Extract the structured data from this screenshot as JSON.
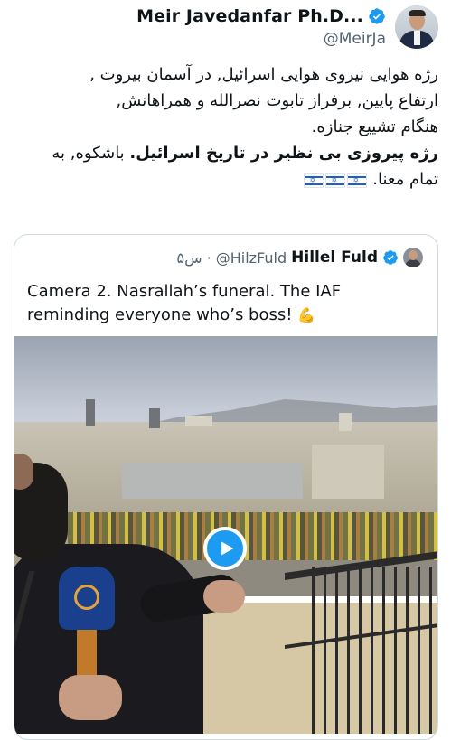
{
  "author": {
    "name": "Meir Javedanfar Ph.D...",
    "handle": "@MeirJa",
    "verified": true
  },
  "tweet": {
    "line1": "رژه هوایی نیروی هوایی اسرائیل, در آسمان بیروت ,",
    "line2": "ارتفاع پایین, برفراز تابوت  نصرالله و همراهانش,",
    "line3": "هنگام تشییع جنازه.",
    "line4_bold": "رژه پیروزی بی نظیر در تاریخ اسرائیل.",
    "line4_rest": " باشکوه, به",
    "line5": "تمام معنا.",
    "flags": [
      "israel-flag",
      "israel-flag",
      "israel-flag"
    ]
  },
  "quoted": {
    "name": "Hillel Fuld",
    "handle": "@HilzFuld",
    "separator": "·",
    "time": "۵س",
    "verified": true,
    "text": "Camera 2. Nasrallah’s funeral. The IAF reminding everyone who’s boss!",
    "emoji": "💪"
  },
  "media": {
    "type": "video",
    "play_icon": "play-icon"
  },
  "colors": {
    "verified_blue": "#1d9bf0",
    "text_primary": "#0f1419",
    "text_secondary": "#536471",
    "border": "#cfd9de"
  }
}
